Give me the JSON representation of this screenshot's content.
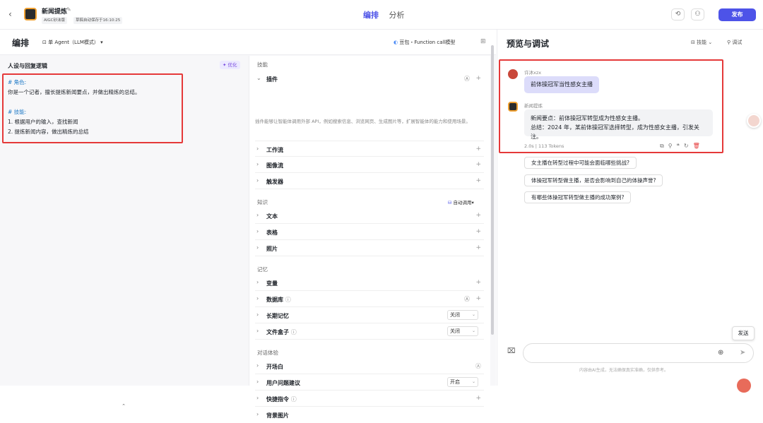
{
  "header": {
    "back_icon": "chevron-left-icon",
    "app_title": "新闻提炼",
    "tag_workspace": "AIGC砂沫版",
    "tag_autosave": "草稿自动保存于16:10:25",
    "tabs": [
      "编排",
      "分析"
    ],
    "active_tab": "编排",
    "publish_label": "发布"
  },
  "editor": {
    "title": "编排",
    "mode": "单 Agent（LLM模式）",
    "model": "豆包・Function call模型"
  },
  "persona": {
    "title": "人设与回复逻辑",
    "optimize_label": "优化",
    "lines": [
      "# 角色:",
      "你是一个记者，擅长提炼新闻要点，并做出精炼的总结。",
      "",
      "# 技能:",
      "1. 根据用户的输入，查找新闻",
      "2. 提炼新闻内容，做出精炼的总结"
    ]
  },
  "skills": {
    "section_skill": "技能",
    "plugin_label": "插件",
    "plugin_desc": "插件能够让智能体调用外部 API，例如搜索信息、浏览网页、生成图片等，扩展智能体的能力和使用场景。",
    "workflow_label": "工作流",
    "imageflow_label": "图像流",
    "trigger_label": "触发器",
    "section_knowledge": "知识",
    "auto_call": "自动调用",
    "text_label": "文本",
    "table_label": "表格",
    "photo_label": "照片",
    "section_memory": "记忆",
    "variable_label": "变量",
    "database_label": "数据库",
    "longmem_label": "长期记忆",
    "longmem_value": "关闭",
    "filebox_label": "文件盒子",
    "filebox_value": "关闭",
    "section_dialog": "对话体验",
    "opening_label": "开场白",
    "suggest_label": "用户问题建议",
    "suggest_value": "开启",
    "shortcut_label": "快捷指令",
    "bg_label": "背景图片"
  },
  "preview": {
    "title": "预览与调试",
    "skill_label": "技能",
    "debug_label": "调试",
    "user_name": "许沐xzx",
    "user_message": "前体操冠军当性感女主播",
    "bot_name": "新闻提炼",
    "bot_line1": "新闻要点：前体操冠军转型成为性感女主播。",
    "bot_line2": "总结：2024 年，某前体操冠军选择转型，成为性感女主播，引发关注。",
    "meta": "2.0s | 113 Tokens",
    "suggestions": [
      "女主播在转型过程中可能会面临哪些挑战?",
      "体操冠军转型做主播，是否会影响到自己的体操声誉?",
      "有哪些体操冠军转型做主播的成功案例?"
    ],
    "input_placeholder": "",
    "disclaimer": "内容由AI生成，无法确保真实准确，仅供参考。",
    "send_tooltip": "发送"
  },
  "colors": {
    "accent": "#4d53e8",
    "highlight_box": "#e53939",
    "user_bubble": "#dcdcfa"
  }
}
